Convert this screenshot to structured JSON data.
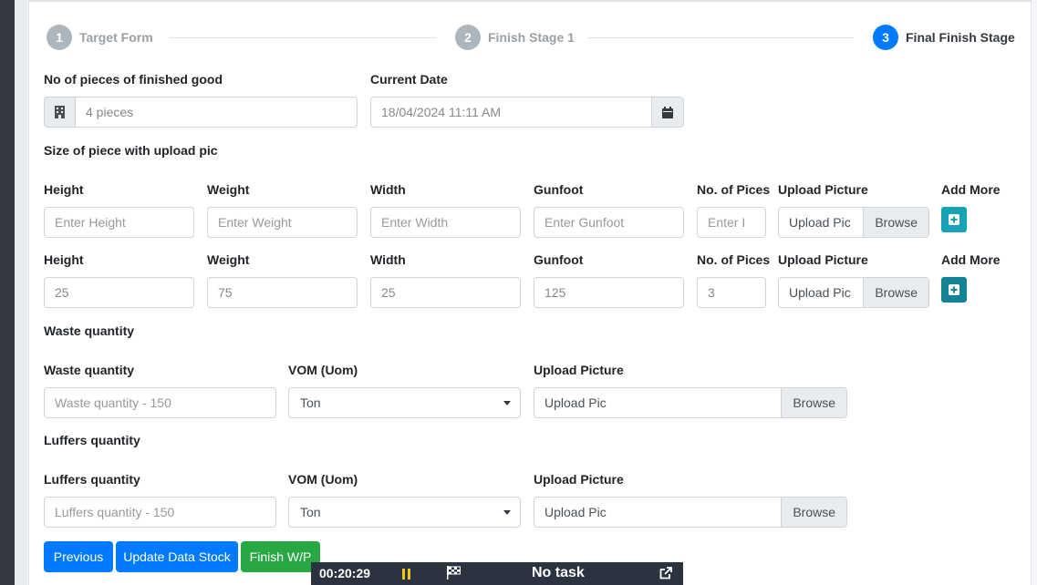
{
  "stepper": {
    "steps": [
      {
        "number": "1",
        "label": "Target Form"
      },
      {
        "number": "2",
        "label": "Finish Stage 1"
      },
      {
        "number": "3",
        "label": "Final Finish Stage"
      }
    ]
  },
  "top": {
    "pieces_label": "No of pieces of finished good",
    "pieces_value": "4 pieces",
    "date_label": "Current Date",
    "date_value": "18/04/2024 11:11 AM"
  },
  "size_section": {
    "title": "Size of piece with upload pic",
    "headers": {
      "height": "Height",
      "weight": "Weight",
      "width": "Width",
      "gunfoot": "Gunfoot",
      "pieces": "No. of Pices",
      "upload": "Upload Picture",
      "add_more": "Add More"
    },
    "row1": {
      "height": "Enter Height",
      "weight": "Enter Weight",
      "width": "Enter Width",
      "gunfoot": "Enter Gunfoot",
      "pieces": "Enter I",
      "upload": "Upload Pic",
      "browse": "Browse"
    },
    "row2": {
      "height": "25",
      "weight": "75",
      "width": "25",
      "gunfoot": "125",
      "pieces": "3",
      "upload": "Upload Pic",
      "browse": "Browse"
    }
  },
  "waste": {
    "title": "Waste quantity",
    "qty_label": "Waste quantity",
    "qty_placeholder": "Waste quantity - 150",
    "uom_label": "VOM (Uom)",
    "uom_value": "Ton",
    "upload_label": "Upload Picture",
    "upload_text": "Upload Pic",
    "browse": "Browse"
  },
  "luffers": {
    "title": "Luffers quantity",
    "qty_label": "Luffers quantity",
    "qty_placeholder": "Luffers quantity - 150",
    "uom_label": "VOM (Uom)",
    "uom_value": "Ton",
    "upload_label": "Upload Picture",
    "upload_text": "Upload Pic",
    "browse": "Browse"
  },
  "actions": {
    "previous": "Previous",
    "update": "Update Data Stock",
    "finish": "Finish W/P"
  },
  "timer": {
    "time": "00:20:29",
    "task": "No task"
  },
  "colors": {
    "primary": "#007bff",
    "success": "#28a745",
    "info": "#17a2b8"
  }
}
